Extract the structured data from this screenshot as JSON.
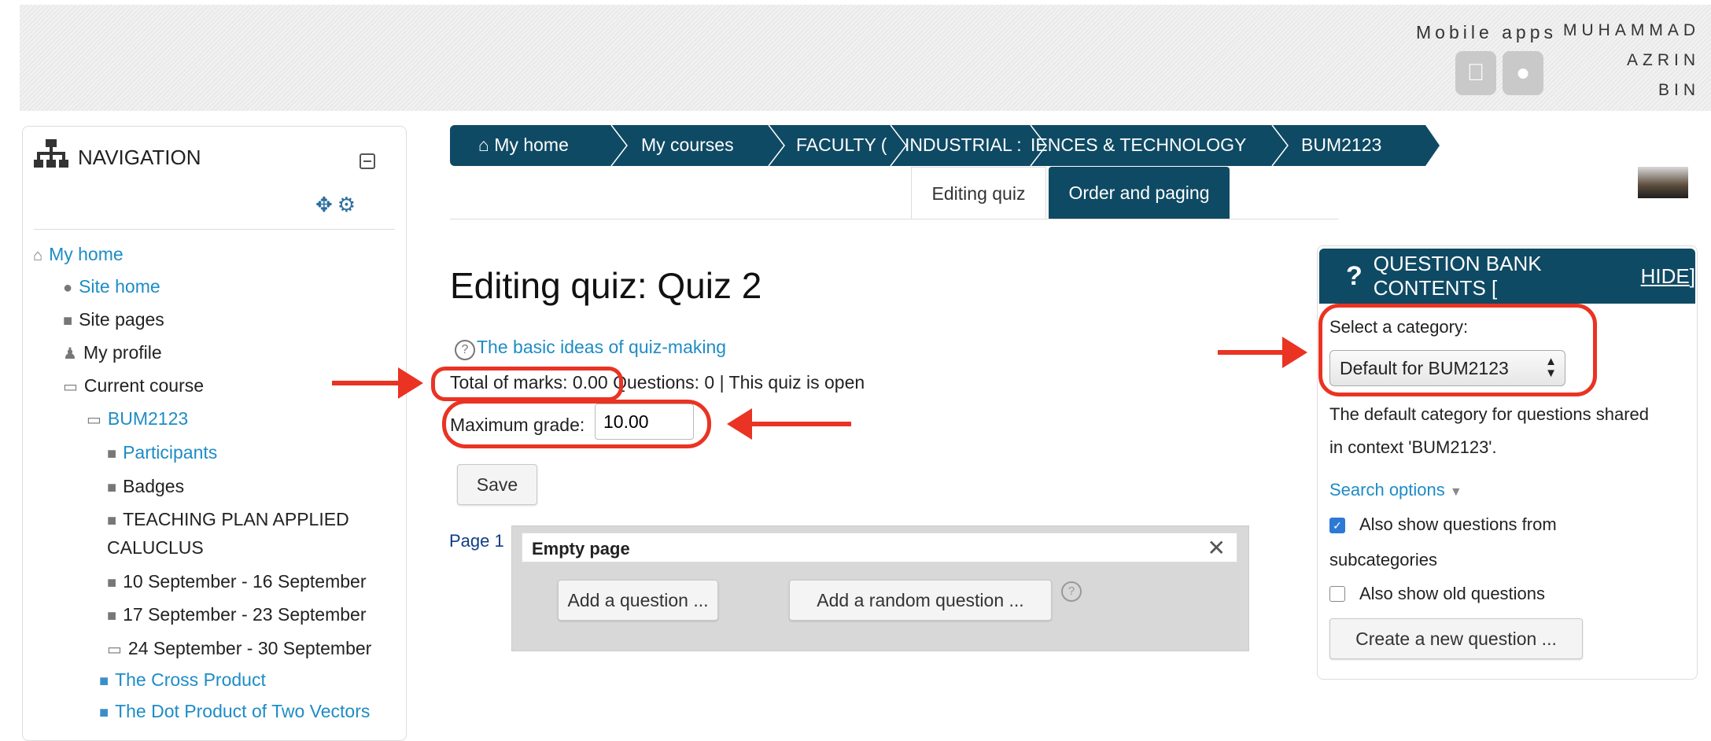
{
  "header": {
    "mobile_apps_label": "Mobile apps",
    "user_name_line1": "MUHAMMAD",
    "user_name_line2": "AZRIN",
    "user_name_line3": "BIN"
  },
  "navigation": {
    "title": "NAVIGATION",
    "items": [
      {
        "label": "My home",
        "icon": "home-icon"
      },
      {
        "label": "Site home",
        "icon": "circle-icon"
      },
      {
        "label": "Site pages",
        "icon": "folder-icon"
      },
      {
        "label": "My profile",
        "icon": "user-icon"
      },
      {
        "label": "Current course",
        "icon": "folder-open-icon"
      },
      {
        "label": "BUM2123",
        "icon": "folder-open-icon"
      },
      {
        "label": "Participants",
        "icon": "folder-icon"
      },
      {
        "label": "Badges",
        "icon": "folder-icon"
      },
      {
        "label": "TEACHING PLAN APPLIED",
        "icon": "folder-icon"
      },
      {
        "label": "CALUCLUS",
        "icon": ""
      },
      {
        "label": "10 September - 16 September",
        "icon": "folder-icon"
      },
      {
        "label": "17 September - 23 September",
        "icon": "folder-icon"
      },
      {
        "label": "24 September - 30 September",
        "icon": "folder-open-icon"
      },
      {
        "label": "The Cross Product",
        "icon": "page-icon"
      },
      {
        "label": "The Dot Product of Two Vectors",
        "icon": "page-icon"
      }
    ]
  },
  "breadcrumb": {
    "items": [
      "My home",
      "My courses",
      "FACULTY (",
      "INDUSTRIAL :",
      "IENCES & TECHNOLOGY",
      "BUM2123"
    ]
  },
  "tabs": {
    "active": "Editing quiz",
    "other": "Order and paging"
  },
  "main": {
    "title": "Editing quiz: Quiz 2",
    "help_link": "The basic ideas of quiz-making",
    "total_marks": "Total of marks: 0.00",
    "questions_status": "Questions: 0 | This quiz is open",
    "max_grade_label": "Maximum grade:",
    "max_grade_value": "10.00",
    "save_label": "Save",
    "page_label": "Page 1",
    "page_title": "Empty page",
    "add_question_label": "Add a question ...",
    "add_random_label": "Add a random question ..."
  },
  "question_bank": {
    "title": "QUESTION BANK CONTENTS [",
    "hide_label": "HIDE",
    "title_end": "]",
    "select_label": "Select a category:",
    "selected_category": "Default for BUM2123",
    "desc_line1": "The default category for questions shared",
    "desc_line2": "in context 'BUM2123'.",
    "search_options": "Search options",
    "subcat_line1": "Also show questions from",
    "subcat_line2": "subcategories",
    "subcat_checked": true,
    "old_questions": "Also show old questions",
    "old_checked": false,
    "create_label": "Create a new question ..."
  },
  "colors": {
    "primary": "#0f4a64",
    "link": "#1e8cc6",
    "annotation": "#ea3323"
  }
}
